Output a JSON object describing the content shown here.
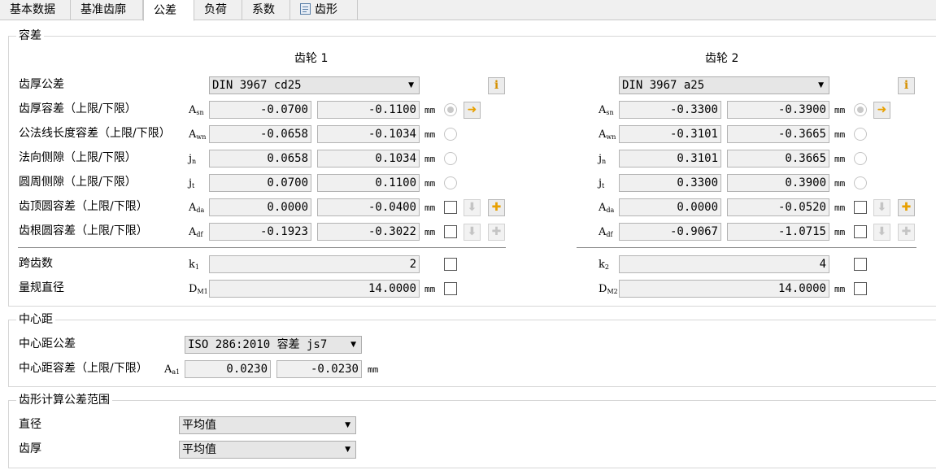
{
  "tabs": [
    {
      "label": "基本数据"
    },
    {
      "label": "基准齿廓"
    },
    {
      "label": "公差"
    },
    {
      "label": "负荷"
    },
    {
      "label": "系数"
    },
    {
      "label": "齿形"
    }
  ],
  "tolerance": {
    "title": "容差",
    "gear1_title": "齿轮 1",
    "gear2_title": "齿轮 2",
    "row_labels": {
      "thickness_tol": "齿厚公差",
      "thickness_dev": "齿厚容差（上限/下限）",
      "base_tangent": "公法线长度容差（上限/下限）",
      "normal_backlash": "法向侧隙（上限/下限）",
      "circ_backlash": "圆周侧隙（上限/下限）",
      "tip_dev": "齿顶圆容差（上限/下限）",
      "root_dev": "齿根圆容差（上限/下限）",
      "span_teeth": "跨齿数",
      "ball_dia": "量规直径"
    },
    "sym": {
      "A": "A",
      "j": "j",
      "k": "k",
      "D": "D",
      "sn": "sn",
      "wn": "wn",
      "n": "n",
      "t": "t",
      "da": "da",
      "df": "df",
      "M1": "M1",
      "M2": "M2",
      "k1": "1",
      "k2": "2"
    },
    "unit": "mm",
    "gear1": {
      "tol_select": "DIN 3967 cd25",
      "asn": [
        "-0.0700",
        "-0.1100"
      ],
      "awn": [
        "-0.0658",
        "-0.1034"
      ],
      "jn": [
        "0.0658",
        "0.1034"
      ],
      "jt": [
        "0.0700",
        "0.1100"
      ],
      "ada": [
        "0.0000",
        "-0.0400"
      ],
      "adf": [
        "-0.1923",
        "-0.3022"
      ],
      "k": "2",
      "dm": "14.0000"
    },
    "gear2": {
      "tol_select": "DIN 3967 a25",
      "asn": [
        "-0.3300",
        "-0.3900"
      ],
      "awn": [
        "-0.3101",
        "-0.3665"
      ],
      "jn": [
        "0.3101",
        "0.3665"
      ],
      "jt": [
        "0.3300",
        "0.3900"
      ],
      "ada": [
        "0.0000",
        "-0.0520"
      ],
      "adf": [
        "-0.9067",
        "-1.0715"
      ],
      "k": "4",
      "dm": "14.0000"
    }
  },
  "center": {
    "title": "中心距",
    "tol_label": "中心距公差",
    "tol_select": "ISO 286:2010 容差 js7",
    "dev_label": "中心距容差（上限/下限）",
    "sym_sub": "a1",
    "upper": "0.0230",
    "lower": "-0.0230"
  },
  "profile": {
    "title": "齿形计算公差范围",
    "dia_label": "直径",
    "dia_select": "平均值",
    "thk_label": "齿厚",
    "thk_select": "平均值"
  },
  "icons": {
    "info": "i",
    "arrow": "➜",
    "plus": "✚",
    "down": "⬇"
  }
}
